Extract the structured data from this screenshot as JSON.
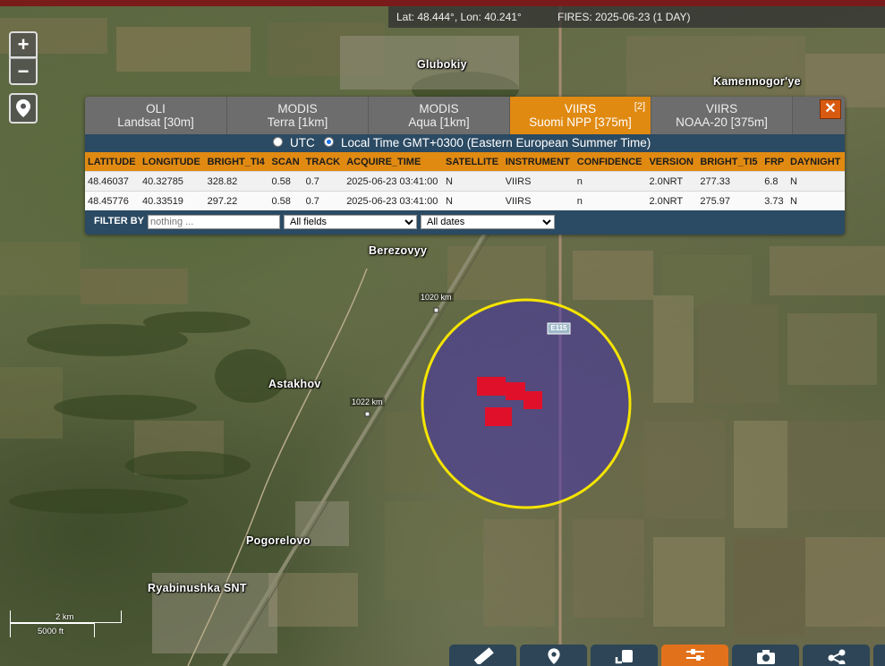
{
  "status_bar": {
    "coordinates": "Lat: 48.444°, Lon: 40.241°",
    "fires": "FIRES: 2025-06-23 (1 DAY)"
  },
  "zoom": {
    "in_label": "+",
    "out_label": "−"
  },
  "places": {
    "glubokiy": "Glubokiy",
    "kamennogorye": "Kamennogor'ye",
    "berezovyy": "Berezovyy",
    "astakhov": "Astakhov",
    "pogorelovo": "Pogorelovo",
    "ryabinushka": "Ryabinushka SNT"
  },
  "road_markers": {
    "km1020": "1020 km",
    "km1022": "1022 km",
    "e115": "E115"
  },
  "popup": {
    "tabs": [
      {
        "line1": "OLI",
        "line2": "Landsat [30m]"
      },
      {
        "line1": "MODIS",
        "line2": "Terra [1km]"
      },
      {
        "line1": "MODIS",
        "line2": "Aqua [1km]"
      },
      {
        "line1": "VIIRS",
        "line2": "Suomi NPP [375m]",
        "badge": "[2]"
      },
      {
        "line1": "VIIRS",
        "line2": "NOAA-20 [375m]"
      }
    ],
    "close_label": "✕",
    "tz_utc": "UTC",
    "tz_local": "Local Time GMT+0300 (Eastern European Summer Time)",
    "columns": [
      "LATITUDE",
      "LONGITUDE",
      "BRIGHT_TI4",
      "SCAN",
      "TRACK",
      "ACQUIRE_TIME",
      "SATELLITE",
      "INSTRUMENT",
      "CONFIDENCE",
      "VERSION",
      "BRIGHT_TI5",
      "FRP",
      "DAYNIGHT"
    ],
    "rows": [
      [
        "48.46037",
        "40.32785",
        "328.82",
        "0.58",
        "0.7",
        "2025-06-23 03:41:00",
        "N",
        "VIIRS",
        "n",
        "2.0NRT",
        "277.33",
        "6.8",
        "N"
      ],
      [
        "48.45776",
        "40.33519",
        "297.22",
        "0.58",
        "0.7",
        "2025-06-23 03:41:00",
        "N",
        "VIIRS",
        "n",
        "2.0NRT",
        "275.97",
        "3.73",
        "N"
      ]
    ],
    "filter_label": "FILTER BY",
    "filter_placeholder": "nothing ...",
    "field_select": "All fields",
    "date_select": "All dates"
  },
  "scale": {
    "km": "2 km",
    "ft": "5000 ft"
  },
  "colors": {
    "accent": "#e08a12",
    "header_red": "#7a1b1b",
    "highlight_circle": "#f5e400",
    "fire_pixel": "#e0102a",
    "toolbar_active": "#e2711c"
  },
  "toolbar": {
    "icons": [
      "ruler-icon",
      "location-pin-icon",
      "layers-icon",
      "settings-sliders-icon",
      "camera-icon",
      "share-icon"
    ]
  }
}
